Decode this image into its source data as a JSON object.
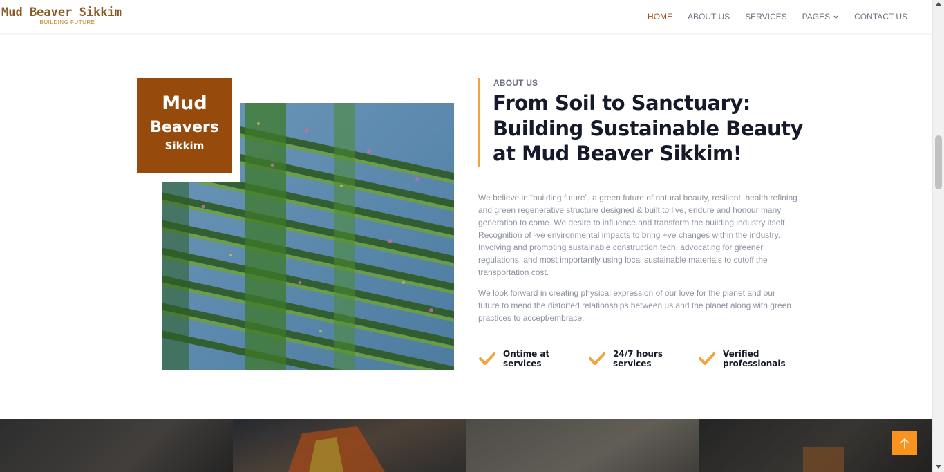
{
  "brand": {
    "name": "Mud Beaver Sikkim",
    "tagline": "BUILDING FUTURE"
  },
  "nav": {
    "items": [
      {
        "label": "HOME",
        "active": true
      },
      {
        "label": "ABOUT US",
        "active": false
      },
      {
        "label": "SERVICES",
        "active": false
      },
      {
        "label": "PAGES",
        "active": false,
        "has_dropdown": true
      },
      {
        "label": "CONTACT US",
        "active": false
      }
    ]
  },
  "badge": {
    "line1": "Mud",
    "line2": "Beavers",
    "line3": "Sikkim"
  },
  "about": {
    "eyebrow": "ABOUT US",
    "heading": "From Soil to Sanctuary: Building Sustainable Beauty at Mud Beaver Sikkim!",
    "paragraph1": "We believe in “building future”, a green future of natural beauty, resilient, health refining and green regenerative structure designed & built to live, endure and honour many generation to come. We desire to influence and transform the building industry itself. Recognition of -ve environmental impacts to bring +ve changes within the industry. Involving and promoting sustainable construction tech, advocating for greener regulations, and most importantly using local sustainable materials to cutoff the transportation cost.",
    "paragraph2": "We look forward in creating physical expression of our love for the planet and our future to mend the distorted relationships between us and the planet along with green practices to accept/embrace.",
    "features": [
      {
        "label": "Ontime at services",
        "icon": "check-icon"
      },
      {
        "label": "24/7 hours services",
        "icon": "check-icon"
      },
      {
        "label": "Verified professionals",
        "icon": "check-icon"
      }
    ]
  },
  "colors": {
    "accent": "#f2a33a",
    "brand_brown": "#964a0b",
    "nav_active": "#a3521c",
    "back_to_top": "#f7931e"
  },
  "icons": {
    "back_to_top": "arrow-up-icon",
    "dropdown": "chevron-down-icon"
  }
}
